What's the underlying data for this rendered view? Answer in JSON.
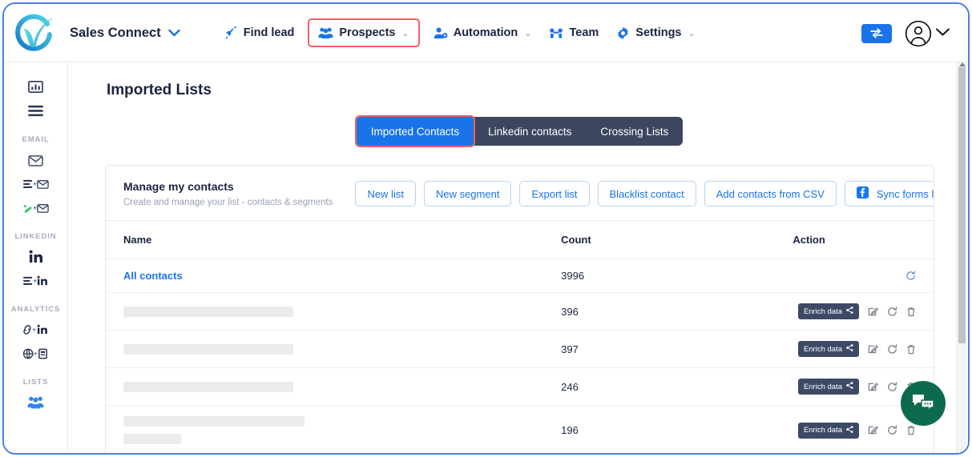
{
  "brand": {
    "name": "Sales Connect",
    "caret": "⌄"
  },
  "topnav": {
    "items": [
      {
        "label": "Find lead",
        "icon": "rocket-icon",
        "caret": "",
        "highlighted": false
      },
      {
        "label": "Prospects",
        "icon": "people-icon",
        "caret": "⌄",
        "highlighted": true
      },
      {
        "label": "Automation",
        "icon": "user-gear-icon",
        "caret": "⌄",
        "highlighted": false
      },
      {
        "label": "Team",
        "icon": "team-icon",
        "caret": "",
        "highlighted": false
      },
      {
        "label": "Settings",
        "icon": "gear-icon",
        "caret": "⌄",
        "highlighted": false
      }
    ],
    "swap_button": "swap-icon",
    "avatar": "user-avatar-icon",
    "avatar_caret": "⌄"
  },
  "sidebar": {
    "groups": [
      {
        "label": "",
        "items": [
          {
            "icon": "analytics-bar-icon"
          },
          {
            "icon": "list-lines-icon"
          }
        ]
      },
      {
        "label": "EMAIL",
        "items": [
          {
            "icon": "envelope-icon"
          },
          {
            "icon": "list-plus-envelope-icon"
          },
          {
            "icon": "magic-wand-envelope-icon"
          }
        ]
      },
      {
        "label": "LINKEDIN",
        "items": [
          {
            "icon": "linkedin-icon"
          },
          {
            "icon": "list-plus-linkedin-icon"
          }
        ]
      },
      {
        "label": "ANALYTICS",
        "items": [
          {
            "icon": "link-plus-linkedin-icon"
          },
          {
            "icon": "globe-plus-card-icon"
          }
        ]
      },
      {
        "label": "LISTS",
        "items": [
          {
            "icon": "people-group-icon"
          }
        ]
      }
    ]
  },
  "main": {
    "page_title": "Imported Lists",
    "tabs": [
      {
        "label": "Imported Contacts",
        "active": true,
        "highlighted": true
      },
      {
        "label": "Linkedin contacts",
        "active": false,
        "highlighted": false
      },
      {
        "label": "Crossing Lists",
        "active": false,
        "highlighted": false
      }
    ],
    "card": {
      "title": "Manage my contacts",
      "subtitle": "Create and manage your list - contacts & segments",
      "buttons": [
        {
          "label": "New list",
          "icon": ""
        },
        {
          "label": "New segment",
          "icon": ""
        },
        {
          "label": "Export list",
          "icon": ""
        },
        {
          "label": "Blacklist contact",
          "icon": ""
        },
        {
          "label": "Add contacts from CSV",
          "icon": ""
        },
        {
          "label": "Sync forms leads",
          "icon": "facebook-icon"
        }
      ],
      "table": {
        "columns": [
          "Name",
          "Count",
          "Action"
        ],
        "rows": [
          {
            "name": "All contacts",
            "redacted": false,
            "count": "3996",
            "enrich": null,
            "actions": [
              "refresh-icon"
            ]
          },
          {
            "name": "",
            "redacted": true,
            "redact_widths": [
              212
            ],
            "count": "396",
            "enrich": "Enrich data",
            "actions": [
              "edit-icon",
              "refresh-icon",
              "trash-icon"
            ]
          },
          {
            "name": "",
            "redacted": true,
            "redact_widths": [
              212
            ],
            "count": "397",
            "enrich": "Enrich data",
            "actions": [
              "edit-icon",
              "refresh-icon",
              "trash-icon"
            ]
          },
          {
            "name": "",
            "redacted": true,
            "redact_widths": [
              212
            ],
            "count": "246",
            "enrich": "Enrich data",
            "actions": [
              "edit-icon",
              "refresh-icon",
              "trash-icon"
            ]
          },
          {
            "name": "",
            "redacted": true,
            "redact_widths": [
              226,
              72
            ],
            "count": "196",
            "enrich": "Enrich data",
            "actions": [
              "edit-icon",
              "refresh-icon",
              "trash-icon"
            ]
          }
        ]
      }
    }
  },
  "chat_widget": {
    "icon": "chat-bubbles-icon"
  },
  "colors": {
    "accent_blue": "#1a73e8",
    "dark_navy": "#1b2440",
    "tabbar_bg": "#3c465f",
    "enrich_badge": "#3c4a66",
    "highlight_red": "#f4615e",
    "chat_green": "#0c6b4f",
    "border_frame": "#4a7fe8"
  }
}
